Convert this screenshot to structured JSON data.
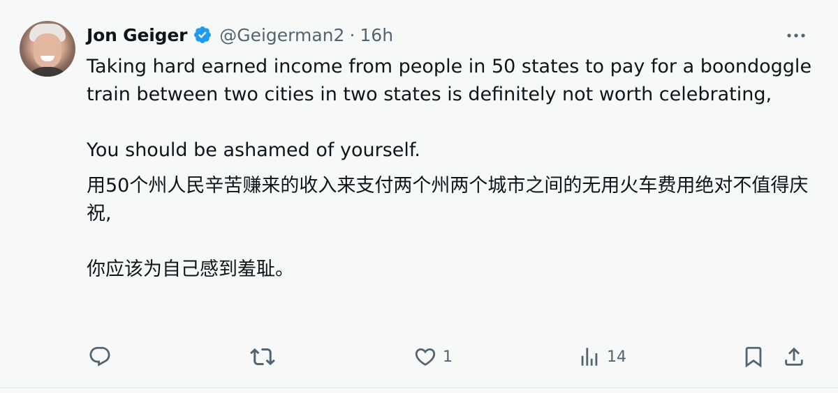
{
  "tweet": {
    "author_name": "Jon Geiger",
    "handle": "@Geigerman2",
    "separator": "·",
    "time": "16h",
    "text_en_1": "Taking hard earned income from people in 50 states to pay for a boondoggle train between two cities in two states is definitely not worth celebrating,",
    "text_en_2": "You should be ashamed of yourself.",
    "text_zh_1": "用50个州人民辛苦赚来的收入来支付两个州两个城市之间的无用火车费用绝对不值得庆祝,",
    "text_zh_2": "你应该为自己感到羞耻。"
  },
  "actions": {
    "reply_count": "",
    "retweet_count": "",
    "like_count": "1",
    "views_count": "14"
  },
  "icons": {
    "verified": "verified-badge-icon",
    "more": "more-icon",
    "reply": "reply-icon",
    "retweet": "retweet-icon",
    "like": "heart-icon",
    "views": "views-icon",
    "bookmark": "bookmark-icon",
    "share": "share-icon"
  },
  "colors": {
    "background": "#f7f9f9",
    "text": "#0f1419",
    "secondary": "#536471",
    "verified": "#1d9bf0"
  }
}
